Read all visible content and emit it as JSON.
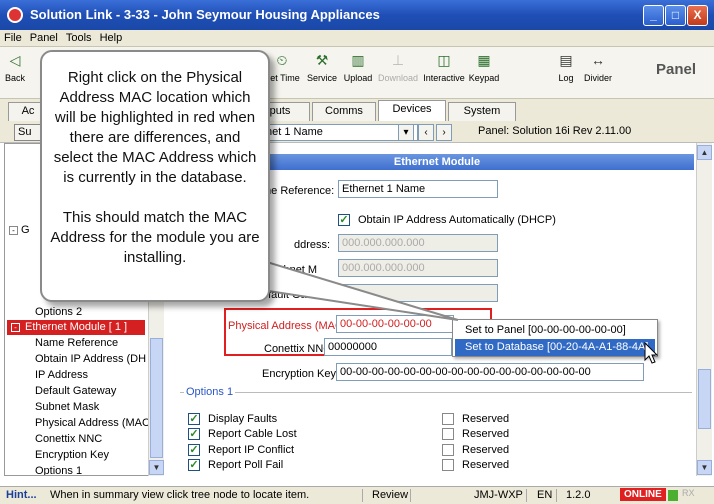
{
  "window": {
    "title": "Solution Link - 3-33 - John Seymour Housing Appliances",
    "min": "_",
    "max": "□",
    "close": "X"
  },
  "menu": [
    "File",
    "Panel",
    "Tools",
    "Help"
  ],
  "toolbar": {
    "items": [
      {
        "label": "Back",
        "icon": "back-icon"
      },
      {
        "label": "Set Time",
        "icon": "clock-icon"
      },
      {
        "label": "Service",
        "icon": "wrench-icon"
      },
      {
        "label": "Upload",
        "icon": "upload-icon"
      },
      {
        "label": "Download",
        "icon": "download-icon",
        "disabled": true
      },
      {
        "label": "Interactive",
        "icon": "interactive-icon"
      },
      {
        "label": "Keypad",
        "icon": "keypad-icon"
      },
      {
        "label": "Log",
        "icon": "log-icon"
      },
      {
        "label": "Divider",
        "icon": "divider-icon"
      }
    ],
    "panel_label": "Panel"
  },
  "tabs": [
    {
      "label": "Ac"
    },
    {
      "label": "puts"
    },
    {
      "label": "Comms"
    },
    {
      "label": "Devices",
      "active": true
    },
    {
      "label": "System"
    }
  ],
  "nav": {
    "left_button": "Su",
    "combo_value": "- Ethernet 1 Name",
    "panel_info": "Panel:  Solution 16i Rev 2.11.00"
  },
  "tree": {
    "collapsed_marker": "G",
    "options2": "Options 2",
    "selected_node": "Ethernet Module [ 1 ]",
    "children": [
      "Name Reference",
      "Obtain IP Address (DH",
      "IP Address",
      "Default Gateway",
      "Subnet Mask",
      "Physical Address (MAC",
      "Conettix NNC",
      "Encryption Key",
      "Options 1"
    ]
  },
  "module": {
    "header": "Ethernet Module",
    "name_ref_label": "me Reference:",
    "name_ref_value": "Ethernet 1 Name",
    "dhcp_label": "Obtain IP Address Automatically (DHCP)",
    "dhcp_checked": true,
    "ip_label": "ddress:",
    "ip_value": "000.000.000.000",
    "subnet_label": "Subnet M",
    "subnet_value": "000.000.000.000",
    "gateway_label": "efault Gateway:",
    "gateway_value": "000.",
    "mac_label": "Physical Address (MAC):",
    "mac_value": "00-00-00-00-00-00",
    "nnc_label": "Conettix NNC:",
    "nnc_value": "00000000",
    "enc_label": "Encryption Key:",
    "enc_value": "00-00-00-00-00-00-00-00-00-00-00-00-00-00-00-00"
  },
  "context_menu": {
    "items": [
      "Set to Panel [00-00-00-00-00-00]",
      "Set to Database [00-20-4A-A1-88-4A]"
    ],
    "selected_index": 1
  },
  "options1": {
    "title": "Options 1",
    "left": [
      {
        "label": "Display Faults",
        "checked": true
      },
      {
        "label": "Report Cable Lost",
        "checked": true
      },
      {
        "label": "Report IP Conflict",
        "checked": true
      },
      {
        "label": "Report Poll Fail",
        "checked": true
      }
    ],
    "right": [
      {
        "label": "Reserved",
        "checked": false
      },
      {
        "label": "Reserved",
        "checked": false
      },
      {
        "label": "Reserved",
        "checked": false
      },
      {
        "label": "Reserved",
        "checked": false
      }
    ]
  },
  "callout": {
    "p1": "Right click on the Physical Address MAC location which will be highlighted in red when there are differences, and select the MAC Address which is currently in the database.",
    "p2": "This should match the MAC Address for the module you are installing."
  },
  "status": {
    "hint_label": "Hint...",
    "hint_text": "When in summary view click tree node to locate item.",
    "review": "Review",
    "computer": "JMJ-WXP",
    "lang": "EN",
    "version": "1.2.0",
    "online": "ONLINE",
    "rx": "RX"
  },
  "colors": {
    "title_bar": "#2458c4",
    "highlight": "#e02020",
    "selection": "#316ac5",
    "online_badge": "#e02020"
  }
}
